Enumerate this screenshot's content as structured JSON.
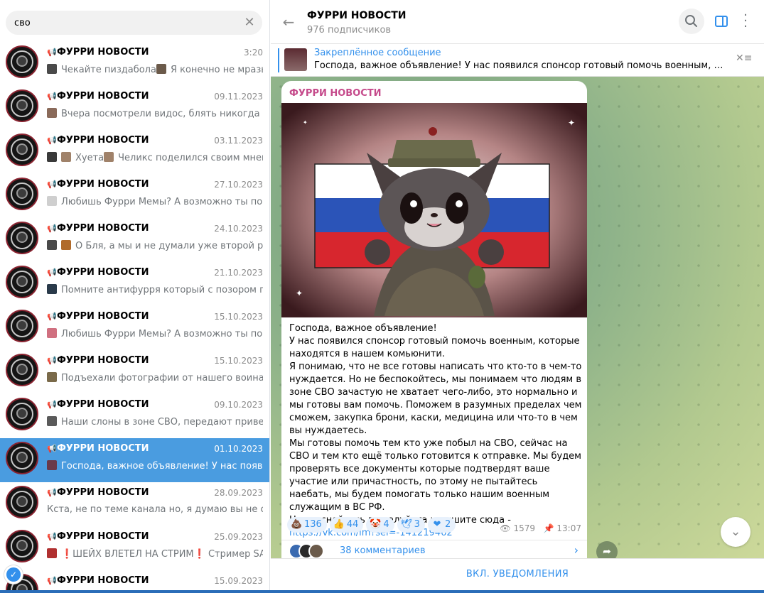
{
  "search": {
    "value": "сво",
    "clear_icon": "close-icon"
  },
  "chat_list": [
    {
      "title": "ФУРРИ НОВОСТИ",
      "date": "3:20",
      "preview": [
        {
          "thumb": "#4a4a4a",
          "text": "Чекайте пиздабола"
        },
        {
          "thumb": "#6b5a4a",
          "text": "Я конечно не мразь, ..."
        }
      ]
    },
    {
      "title": "ФУРРИ НОВОСТИ",
      "date": "09.11.2023",
      "preview": [
        {
          "thumb": "#8a6a5a",
          "text": "Вчера посмотрели видос, блять никогда так..."
        }
      ]
    },
    {
      "title": "ФУРРИ НОВОСТИ",
      "date": "03.11.2023",
      "preview": [
        {
          "thumb": "#3a3a3a",
          "text": ""
        },
        {
          "thumb": "#a0826a",
          "text": "Хуета"
        },
        {
          "thumb": "#a0826a",
          "text": "Челикс поделился своим мнен..."
        }
      ]
    },
    {
      "title": "ФУРРИ НОВОСТИ",
      "date": "27.10.2023",
      "preview": [
        {
          "thumb": "#cfcfcf",
          "text": "Любишь Фурри Мемы?  А возможно ты по..."
        }
      ]
    },
    {
      "title": "ФУРРИ НОВОСТИ",
      "date": "24.10.2023",
      "preview": [
        {
          "thumb": "#4a4a4a",
          "text": ""
        },
        {
          "thumb": "#b06a2a",
          "text": "О Бля, а мы и не думали уже второй раз. ..."
        }
      ]
    },
    {
      "title": "ФУРРИ НОВОСТИ",
      "date": "21.10.2023",
      "preview": [
        {
          "thumb": "#2a3a4a",
          "text": "Помните антифурря который с позором по..."
        }
      ]
    },
    {
      "title": "ФУРРИ НОВОСТИ",
      "date": "15.10.2023",
      "preview": [
        {
          "thumb": "#d07080",
          "text": "Любишь Фурри Мемы? А возможно ты пом..."
        }
      ]
    },
    {
      "title": "ФУРРИ НОВОСТИ",
      "date": "15.10.2023",
      "preview": [
        {
          "thumb": "#7a6a4a",
          "text": "Подъехали фотографии от нашего воина, к..."
        }
      ]
    },
    {
      "title": "ФУРРИ НОВОСТИ",
      "date": "09.10.2023",
      "preview": [
        {
          "thumb": "#5a5a5a",
          "text": "Наши слоны в зоне СВО, передают привет."
        }
      ]
    },
    {
      "title": "ФУРРИ НОВОСТИ",
      "date": "01.10.2023",
      "active": true,
      "preview": [
        {
          "thumb": "#6a3a4a",
          "text": "Господа, важное объявление! У нас появилс..."
        }
      ]
    },
    {
      "title": "ФУРРИ НОВОСТИ",
      "date": "28.09.2023",
      "preview": [
        {
          "thumb": "",
          "text": "Кста, не по теме канала но, я думаю вы не силь..."
        }
      ]
    },
    {
      "title": "ФУРРИ НОВОСТИ",
      "date": "25.09.2023",
      "preview": [
        {
          "thumb": "#b03030",
          "text": "❗ШЕЙХ ВЛЕТЕЛ НА СТРИМ❗ Стример SA..."
        }
      ]
    },
    {
      "title": "ФУРРИ НОВОСТИ",
      "date": "15.09.2023",
      "preview": []
    }
  ],
  "header": {
    "title": "ФУРРИ НОВОСТИ",
    "subscribers": "976 подписчиков",
    "back_icon": "arrow-left-icon",
    "search_icon": "search-icon",
    "panel_icon": "sidebar-toggle-icon",
    "more_icon": "more-vertical-icon"
  },
  "pinned": {
    "title": "Закреплённое сообщение",
    "text": "Господа, важное объявление! У нас появился спонсор готовый помочь военным, которы..."
  },
  "post": {
    "author": "ФУРРИ НОВОСТИ",
    "text_lines": [
      "Господа, важное объявление!",
      "У нас появился спонсор готовый помочь военным, которые находятся в нашем комьюнити.",
      "Я понимаю, что не все готовы написать что кто-то в чем-то нуждается. Но не беспокойтесь, мы понимаем что людям в зоне СВО зачастую не хватает чего-либо, это нормально и мы готовы вам помочь. Поможем в разумных пределах чем сможем, закупка брони, каски, медицина или что-то в чем вы нуждаетесь.",
      "Мы готовы помочь тем кто уже побыл на СВО, сейчас на СВО и тем кто ещё только готовится к отправке. Мы будем проверять все документы которые подтвердят ваше участие или причастность, по этому не пытайтесь наебать, мы будем помогать только нашим военным служащим в ВС РФ.",
      "Не стесняйтесь пожалуйста и пишите сюда - "
    ],
    "link": "https://vk.com/im?sel=-141219462",
    "reactions": [
      {
        "emoji": "💩",
        "count": "136"
      },
      {
        "emoji": "👍",
        "count": "44"
      },
      {
        "emoji": "🤡",
        "count": "4"
      },
      {
        "emoji": "🕊",
        "count": "3"
      },
      {
        "emoji": "❤",
        "count": "2"
      }
    ],
    "views": "1579",
    "time": "13:07",
    "comments": "38 комментариев"
  },
  "footer": {
    "unmute": "ВКЛ. УВЕДОМЛЕНИЯ"
  },
  "colors": {
    "accent": "#3390ec",
    "active_row": "#4a9ce0",
    "author": "#c54a8b"
  }
}
